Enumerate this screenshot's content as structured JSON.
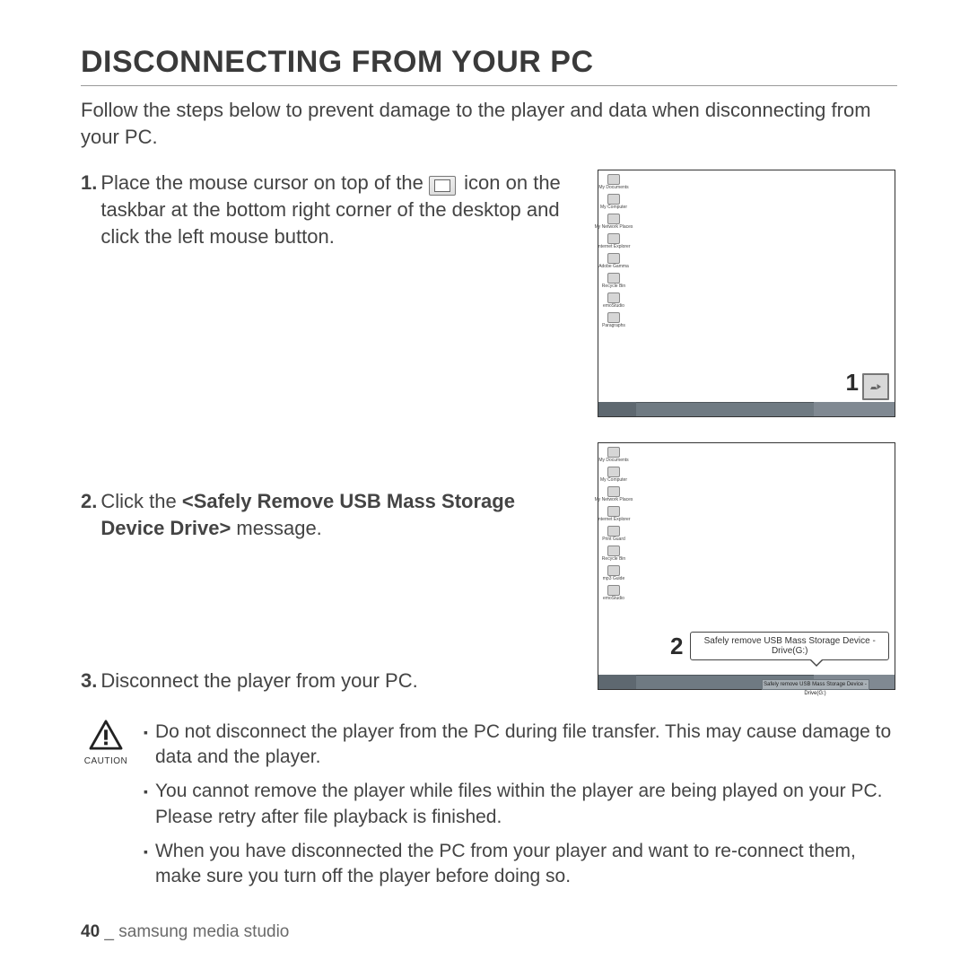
{
  "title": "DISCONNECTING FROM YOUR PC",
  "intro": "Follow the steps below to prevent damage to the player and data when disconnecting from your PC.",
  "step1": {
    "num": "1.",
    "part_a": "Place the mouse cursor on top of the",
    "part_b": "icon on the taskbar at the bottom right corner of the desktop and click the left mouse button."
  },
  "step2": {
    "num": "2.",
    "pre": "Click the ",
    "bold": "<Safely Remove USB Mass Storage Device Drive>",
    "post": " message."
  },
  "step3": {
    "num": "3.",
    "text": "Disconnect the player from your PC."
  },
  "screenshot1": {
    "callout_number": "1",
    "desktop_icons": [
      "My Documents",
      "My Computer",
      "My Network Places",
      "Internet Explorer",
      "Adobe Gamma",
      "Recycle Bin",
      "emoStudio",
      "Paragraphs"
    ]
  },
  "screenshot2": {
    "callout_number": "2",
    "tooltip": "Safely remove USB Mass Storage Device - Drive(G:)",
    "taskbar_button": "Safely remove USB Mass Storage Device - Drive(G:)",
    "desktop_icons": [
      "My Documents",
      "My Computer",
      "My Network Places",
      "Internet Explorer",
      "Print Guard",
      "Recycle Bin",
      "mp3 Guide",
      "emoStudio"
    ]
  },
  "caution": {
    "label": "CAUTION",
    "items": [
      "Do not disconnect the player from the PC during file transfer. This may cause damage to data and the player.",
      "You cannot remove the player while files within the player are being played on your PC. Please retry after file playback is finished.",
      "When you have disconnected the PC from your player and want to re-connect them, make sure you turn off the player before doing so."
    ]
  },
  "footer": {
    "page": "40",
    "sep": " _ ",
    "section": "samsung media studio"
  }
}
